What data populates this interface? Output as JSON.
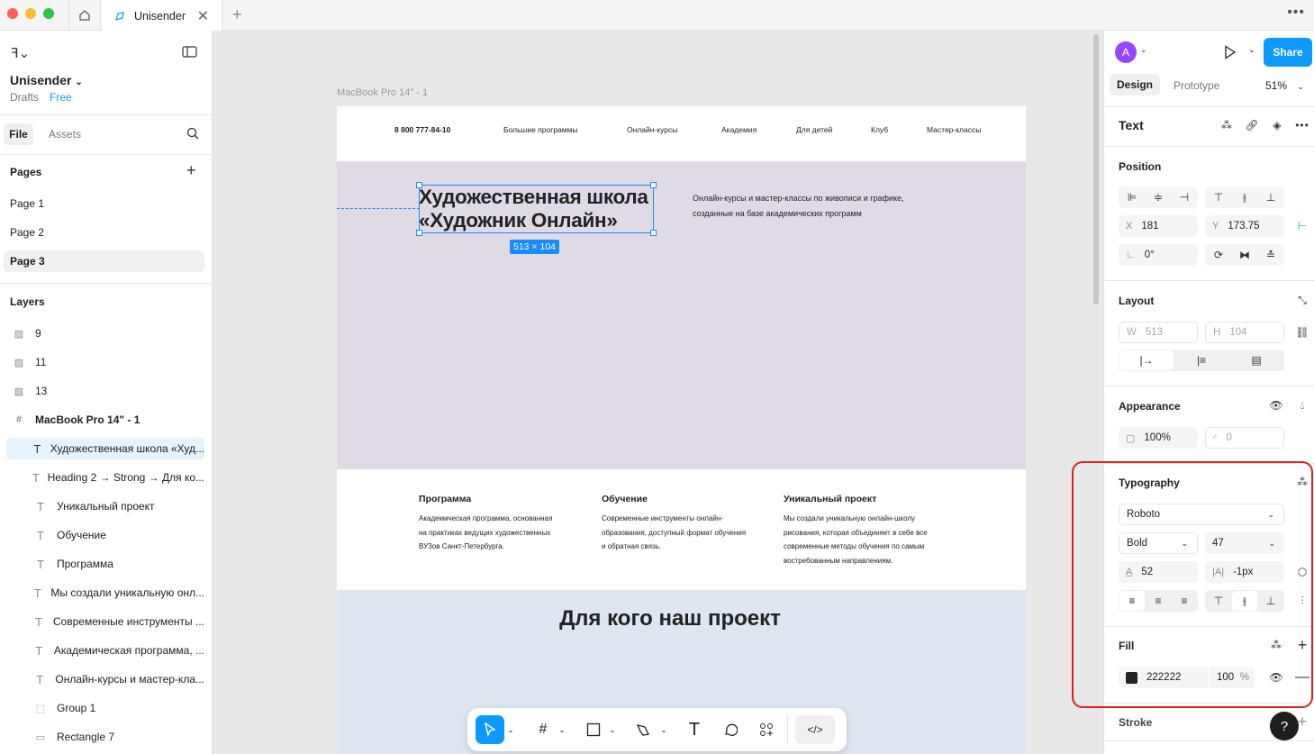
{
  "window": {
    "tab_title": "Unisender"
  },
  "left_panel": {
    "file_name": "Unisender",
    "drafts": "Drafts",
    "plan": "Free",
    "tabs": [
      "File",
      "Assets"
    ],
    "pages_title": "Pages",
    "pages": [
      "Page 1",
      "Page 2",
      "Page 3"
    ],
    "layers_title": "Layers",
    "layers": [
      {
        "icon": "image-icon",
        "name": "9"
      },
      {
        "icon": "image-icon",
        "name": "11"
      },
      {
        "icon": "image-icon",
        "name": "13"
      },
      {
        "icon": "frame-icon",
        "name": "MacBook Pro 14\" - 1"
      },
      {
        "icon": "text-icon",
        "name": "Художественная школа «Худ..."
      },
      {
        "icon": "text-icon",
        "name": "Heading 2 → Strong → Для ко..."
      },
      {
        "icon": "text-icon",
        "name": "Уникальный проект"
      },
      {
        "icon": "text-icon",
        "name": "Обучение"
      },
      {
        "icon": "text-icon",
        "name": "Программа"
      },
      {
        "icon": "text-icon",
        "name": "Мы создали уникальную онл..."
      },
      {
        "icon": "text-icon",
        "name": "Современные инструменты ..."
      },
      {
        "icon": "text-icon",
        "name": "Академическая программа, ..."
      },
      {
        "icon": "text-icon",
        "name": "Онлайн-курсы и мастер-кла..."
      },
      {
        "icon": "group-icon",
        "name": "Group 1"
      },
      {
        "icon": "rectangle-icon",
        "name": "Rectangle 7"
      }
    ]
  },
  "canvas": {
    "frame_label": "MacBook Pro 14\" - 1",
    "nav": [
      "8 800 777-84-10",
      "Большие программы",
      "Онлайн-курсы",
      "Академия",
      "Для детей",
      "Клуб",
      "Мастер-классы"
    ],
    "hero_title_1": "Художественная школа",
    "hero_title_2": "«Художник Онлайн»",
    "size_badge": "513 × 104",
    "hero_text_1": "Онлайн-курсы и мастер-классы по живописи и графике,",
    "hero_text_2": "созданные на базе академических программ",
    "features": [
      {
        "title": "Программа",
        "lines": [
          "Академическая программа, основанная",
          "на практиках ведущих художественных",
          "ВУЗов Санкт-Петербурга."
        ]
      },
      {
        "title": "Обучение",
        "lines": [
          "Современные инструменты онлайн-",
          "образования, доступный формат обучения",
          "и обратная связь."
        ]
      },
      {
        "title": "Уникальный проект",
        "lines": [
          "Мы создали уникальную онлайн-школу",
          "рисования, которая объединяет в себе все",
          "современные методы обучения по самым",
          "востребованным направлениям."
        ]
      }
    ],
    "section_title": "Для кого наш проект"
  },
  "right_panel": {
    "avatar_letter": "A",
    "share": "Share",
    "tabs": [
      "Design",
      "Prototype"
    ],
    "zoom": "51%",
    "layer_type": "Text",
    "position_title": "Position",
    "x_label": "X",
    "x": "181",
    "y_label": "Y",
    "y": "173.75",
    "rotation": "0°",
    "layout_title": "Layout",
    "w_label": "W",
    "w": "513",
    "h_label": "H",
    "h": "104",
    "appearance_title": "Appearance",
    "opacity": "100%",
    "radius": "0",
    "typography_title": "Typography",
    "font_family": "Roboto",
    "font_weight": "Bold",
    "font_size": "47",
    "line_height": "52",
    "letter_spacing": "-1px",
    "fill_title": "Fill",
    "fill_hex": "222222",
    "fill_opacity": "100",
    "fill_pct": "%",
    "stroke_title": "Stroke",
    "help": "?"
  },
  "colors": {
    "accent": "#0d99ff",
    "highlight": "#e02020",
    "fill": "#222222"
  }
}
